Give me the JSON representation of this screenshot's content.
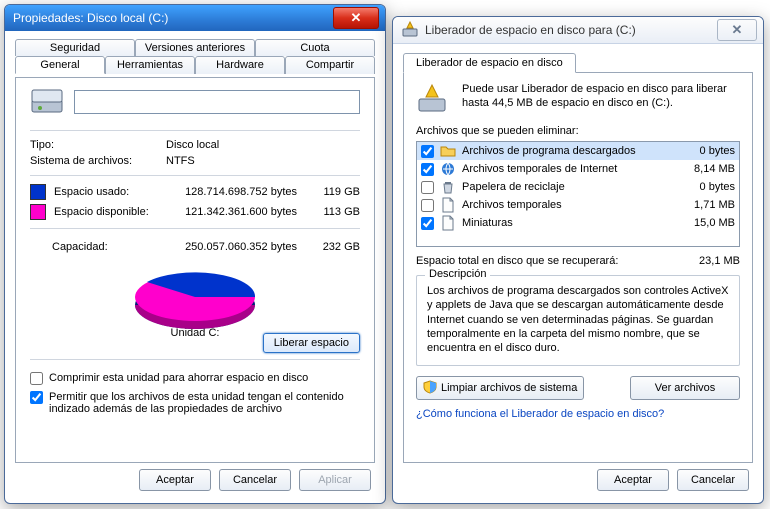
{
  "left": {
    "title": "Propiedades: Disco local (C:)",
    "tabs_row1": [
      "Seguridad",
      "Versiones anteriores",
      "Cuota"
    ],
    "tabs_row2": [
      "General",
      "Herramientas",
      "Hardware",
      "Compartir"
    ],
    "active_tab": "General",
    "type_label": "Tipo:",
    "type_value": "Disco local",
    "fs_label": "Sistema de archivos:",
    "fs_value": "NTFS",
    "used_label": "Espacio usado:",
    "used_bytes": "128.714.698.752 bytes",
    "used_size": "119 GB",
    "free_label": "Espacio disponible:",
    "free_bytes": "121.342.361.600 bytes",
    "free_size": "113 GB",
    "capacity_label": "Capacidad:",
    "capacity_bytes": "250.057.060.352 bytes",
    "capacity_size": "232 GB",
    "chart_data": {
      "type": "pie",
      "title": "Unidad C:",
      "series": [
        {
          "name": "Espacio usado",
          "value": 119,
          "color": "#0033cc"
        },
        {
          "name": "Espacio disponible",
          "value": 113,
          "color": "#ff00cc"
        }
      ],
      "unit": "GB"
    },
    "drive_caption": "Unidad C:",
    "btn_liberar": "Liberar espacio",
    "chk_compress_label": "Comprimir esta unidad para ahorrar espacio en disco",
    "chk_compress": false,
    "chk_index_label": "Permitir que los archivos de esta unidad tengan el contenido indizado además de las propiedades de archivo",
    "chk_index": true,
    "btn_ok": "Aceptar",
    "btn_cancel": "Cancelar",
    "btn_apply": "Aplicar"
  },
  "right": {
    "title": "Liberador de espacio en disco para  (C:)",
    "tab_label": "Liberador de espacio en disco",
    "intro": "Puede usar Liberador de espacio en disco para liberar hasta 44,5 MB de espacio en disco en  (C:).",
    "list_label": "Archivos que se pueden eliminar:",
    "items": [
      {
        "checked": true,
        "icon": "folder",
        "name": "Archivos de programa descargados",
        "size": "0 bytes",
        "selected": true
      },
      {
        "checked": true,
        "icon": "ie",
        "name": "Archivos temporales de Internet",
        "size": "8,14 MB"
      },
      {
        "checked": false,
        "icon": "recycle",
        "name": "Papelera de reciclaje",
        "size": "0 bytes"
      },
      {
        "checked": false,
        "icon": "file",
        "name": "Archivos temporales",
        "size": "1,71 MB"
      },
      {
        "checked": true,
        "icon": "file",
        "name": "Miniaturas",
        "size": "15,0 MB"
      }
    ],
    "total_label": "Espacio total en disco que se recuperará:",
    "total_value": "23,1 MB",
    "desc_legend": "Descripción",
    "desc_text": "Los archivos de programa descargados son controles ActiveX y applets de Java que se descargan automáticamente desde Internet cuando se ven determinadas páginas. Se guardan temporalmente en la carpeta del mismo nombre, que se encuentra en el disco duro.",
    "btn_syscleanup": "Limpiar archivos de sistema",
    "btn_viewfiles": "Ver archivos",
    "help_link": "¿Cómo funciona el Liberador de espacio en disco?",
    "btn_ok": "Aceptar",
    "btn_cancel": "Cancelar"
  }
}
